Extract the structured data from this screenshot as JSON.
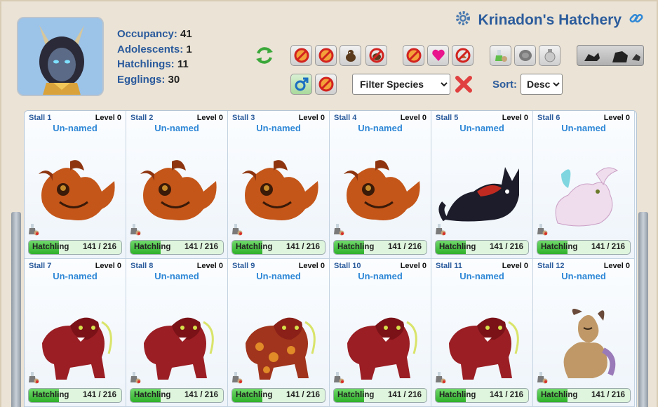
{
  "header": {
    "title": "Krinadon's Hatchery",
    "settings_icon": "gear-icon",
    "link_icon": "link-icon",
    "stats": [
      {
        "label": "Occupancy:",
        "value": "41"
      },
      {
        "label": "Adolescents:",
        "value": "1"
      },
      {
        "label": "Hatchlings:",
        "value": "11"
      },
      {
        "label": "Egglings:",
        "value": "30"
      }
    ]
  },
  "toolbar": {
    "refresh_icon": "refresh-icon",
    "filter_buttons": [
      {
        "name": "no-breed-filter-1",
        "icon": "no-icon"
      },
      {
        "name": "no-breed-filter-2",
        "icon": "no-icon"
      },
      {
        "name": "creature-filter",
        "icon": "creature-icon"
      },
      {
        "name": "no-creature-filter",
        "icon": "no-creature-icon"
      },
      {
        "name": "no-filter-3",
        "icon": "no-icon"
      },
      {
        "name": "heart-filter",
        "icon": "heart-icon"
      },
      {
        "name": "no-filter-4",
        "icon": "no-icon"
      },
      {
        "name": "potion-filter",
        "icon": "potion-icon"
      },
      {
        "name": "stone-filter",
        "icon": "stone-icon"
      },
      {
        "name": "jar-filter",
        "icon": "jar-icon"
      },
      {
        "name": "male-filter",
        "icon": "male-icon"
      },
      {
        "name": "female-filter",
        "icon": "female-icon"
      }
    ],
    "species_filter": "Filter Species",
    "sort_label": "Sort:",
    "sort_value": "Desc",
    "colors": {
      "accent": "#2c5c9c",
      "name": "#2e87d6",
      "bar": "#2fb02a"
    }
  },
  "stalls": [
    {
      "name": "Stall 1",
      "level": "Level 0",
      "dragon": "Un-named",
      "stage": "Hatchling",
      "progress": "141 / 216",
      "creature": "orange-dragon"
    },
    {
      "name": "Stall 2",
      "level": "Level 0",
      "dragon": "Un-named",
      "stage": "Hatchling",
      "progress": "141 / 216",
      "creature": "orange-dragon"
    },
    {
      "name": "Stall 3",
      "level": "Level 0",
      "dragon": "Un-named",
      "stage": "Hatchling",
      "progress": "141 / 216",
      "creature": "orange-dragon"
    },
    {
      "name": "Stall 4",
      "level": "Level 0",
      "dragon": "Un-named",
      "stage": "Hatchling",
      "progress": "141 / 216",
      "creature": "orange-dragon"
    },
    {
      "name": "Stall 5",
      "level": "Level 0",
      "dragon": "Un-named",
      "stage": "Hatchling",
      "progress": "141 / 216",
      "creature": "black-dragon"
    },
    {
      "name": "Stall 6",
      "level": "Level 0",
      "dragon": "Un-named",
      "stage": "Hatchling",
      "progress": "141 / 216",
      "creature": "white-dragon"
    },
    {
      "name": "Stall 7",
      "level": "Level 0",
      "dragon": "Un-named",
      "stage": "Hatchling",
      "progress": "141 / 216",
      "creature": "red-beast"
    },
    {
      "name": "Stall 8",
      "level": "Level 0",
      "dragon": "Un-named",
      "stage": "Hatchling",
      "progress": "141 / 216",
      "creature": "red-beast"
    },
    {
      "name": "Stall 9",
      "level": "Level 0",
      "dragon": "Un-named",
      "stage": "Hatchling",
      "progress": "141 / 216",
      "creature": "patterned-beast"
    },
    {
      "name": "Stall 10",
      "level": "Level 0",
      "dragon": "Un-named",
      "stage": "Hatchling",
      "progress": "141 / 216",
      "creature": "red-beast"
    },
    {
      "name": "Stall 11",
      "level": "Level 0",
      "dragon": "Un-named",
      "stage": "Hatchling",
      "progress": "141 / 216",
      "creature": "red-beast"
    },
    {
      "name": "Stall 12",
      "level": "Level 0",
      "dragon": "Un-named",
      "stage": "Hatchling",
      "progress": "141 / 216",
      "creature": "tan-dragon"
    }
  ],
  "progress_fraction": 0.653
}
